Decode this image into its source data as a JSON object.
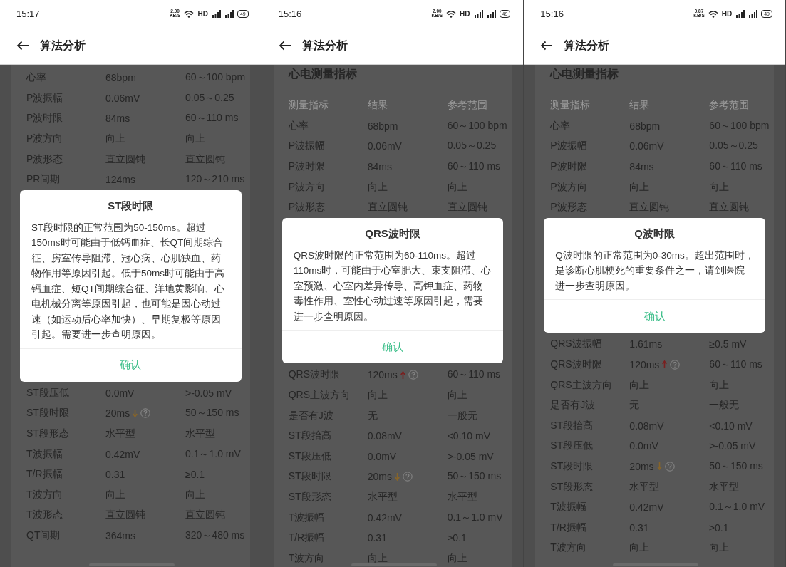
{
  "screens": [
    {
      "status_bar": {
        "time": "15:17",
        "net_speed": "2.00",
        "net_unit": "KB/S",
        "hd": "HD",
        "battery": "49"
      },
      "app_bar": {
        "title": "算法分析"
      },
      "rows": [
        {
          "name": "心率",
          "result": "68bpm",
          "reference": "60～100 bpm",
          "kind": "normal"
        },
        {
          "name": "P波振幅",
          "result": "0.06mV",
          "reference": "0.05～0.25",
          "kind": "normal"
        },
        {
          "name": "P波时限",
          "result": "84ms",
          "reference": "60～110 ms",
          "kind": "normal"
        },
        {
          "name": "P波方向",
          "result": "向上",
          "reference": "向上",
          "kind": "normal"
        },
        {
          "name": "P波形态",
          "result": "直立圆钝",
          "reference": "直立圆钝",
          "kind": "normal"
        },
        {
          "name": "PR间期",
          "result": "124ms",
          "reference": "120～210 ms",
          "kind": "normal"
        }
      ],
      "dialog": {
        "title": "ST段时限",
        "message": "ST段时限的正常范围为50-150ms。超过150ms时可能由于低钙血症、长QT间期综合征、房室传导阻滞、冠心病、心肌缺血、药物作用等原因引起。低于50ms时可能由于高钙血症、短QT间期综合征、洋地黄影响、心电机械分离等原因引起，也可能是因心动过速（如运动后心率加快）、早期复极等原因引起。需要进一步查明原因。",
        "button": "确认"
      },
      "rows_below": [
        {
          "name": "ST段压低",
          "result": "0.0mV",
          "reference": ">-0.05 mV",
          "kind": "normal"
        },
        {
          "name": "ST段时限",
          "result": "20ms",
          "reference": "50～150 ms",
          "kind": "low"
        },
        {
          "name": "ST段形态",
          "result": "水平型",
          "reference": "水平型",
          "kind": "normal"
        },
        {
          "name": "T波振幅",
          "result": "0.42mV",
          "reference": "0.1～1.0 mV",
          "kind": "normal"
        },
        {
          "name": "T/R振幅",
          "result": "0.31",
          "reference": "≥0.1",
          "kind": "normal"
        },
        {
          "name": "T波方向",
          "result": "向上",
          "reference": "向上",
          "kind": "normal"
        },
        {
          "name": "T波形态",
          "result": "直立圆钝",
          "reference": "直立圆钝",
          "kind": "normal"
        },
        {
          "name": "QT间期",
          "result": "364ms",
          "reference": "320～480 ms",
          "kind": "normal"
        }
      ]
    },
    {
      "status_bar": {
        "time": "15:16",
        "net_speed": "2.00",
        "net_unit": "KB/S",
        "hd": "HD",
        "battery": "49"
      },
      "app_bar": {
        "title": "算法分析"
      },
      "section_title": "心电测量指标",
      "columns": [
        "测量指标",
        "结果",
        "参考范围"
      ],
      "rows": [
        {
          "name": "心率",
          "result": "68bpm",
          "reference": "60～100 bpm",
          "kind": "normal"
        },
        {
          "name": "P波振幅",
          "result": "0.06mV",
          "reference": "0.05～0.25",
          "kind": "normal"
        },
        {
          "name": "P波时限",
          "result": "84ms",
          "reference": "60～110 ms",
          "kind": "normal"
        },
        {
          "name": "P波方向",
          "result": "向上",
          "reference": "向上",
          "kind": "normal"
        },
        {
          "name": "P波形态",
          "result": "直立圆钝",
          "reference": "直立圆钝",
          "kind": "normal"
        }
      ],
      "dialog": {
        "title": "QRS波时限",
        "message": "QRS波时限的正常范围为60-110ms。超过110ms时，可能由于心室肥大、束支阻滞、心室预激、心室内差异传导、高钾血症、药物毒性作用、室性心动过速等原因引起，需要进一步查明原因。",
        "button": "确认"
      },
      "rows_below": [
        {
          "name": "QRS波时限",
          "result": "120ms",
          "reference": "60～110 ms",
          "kind": "high"
        },
        {
          "name": "QRS主波方向",
          "result": "向上",
          "reference": "向上",
          "kind": "normal"
        },
        {
          "name": "是否有J波",
          "result": "无",
          "reference": "一般无",
          "kind": "normal"
        },
        {
          "name": "ST段抬高",
          "result": "0.08mV",
          "reference": "<0.10 mV",
          "kind": "normal"
        },
        {
          "name": "ST段压低",
          "result": "0.0mV",
          "reference": ">-0.05 mV",
          "kind": "normal"
        },
        {
          "name": "ST段时限",
          "result": "20ms",
          "reference": "50～150 ms",
          "kind": "low"
        },
        {
          "name": "ST段形态",
          "result": "水平型",
          "reference": "水平型",
          "kind": "normal"
        },
        {
          "name": "T波振幅",
          "result": "0.42mV",
          "reference": "0.1～1.0 mV",
          "kind": "normal"
        },
        {
          "name": "T/R振幅",
          "result": "0.31",
          "reference": "≥0.1",
          "kind": "normal"
        },
        {
          "name": "T波方向",
          "result": "向上",
          "reference": "向上",
          "kind": "normal"
        }
      ]
    },
    {
      "status_bar": {
        "time": "15:16",
        "net_speed": "0.87",
        "net_unit": "KB/S",
        "hd": "HD",
        "battery": "49"
      },
      "app_bar": {
        "title": "算法分析"
      },
      "section_title": "心电测量指标",
      "columns": [
        "测量指标",
        "结果",
        "参考范围"
      ],
      "rows": [
        {
          "name": "心率",
          "result": "68bpm",
          "reference": "60～100 bpm",
          "kind": "normal"
        },
        {
          "name": "P波振幅",
          "result": "0.06mV",
          "reference": "0.05～0.25",
          "kind": "normal"
        },
        {
          "name": "P波时限",
          "result": "84ms",
          "reference": "60～110 ms",
          "kind": "normal"
        },
        {
          "name": "P波方向",
          "result": "向上",
          "reference": "向上",
          "kind": "normal"
        },
        {
          "name": "P波形态",
          "result": "直立圆钝",
          "reference": "直立圆钝",
          "kind": "normal"
        }
      ],
      "dialog": {
        "title": "Q波时限",
        "message": "Q波时限的正常范围为0-30ms。超出范围时，是诊断心肌梗死的重要条件之一，请到医院进一步查明原因。",
        "button": "确认"
      },
      "rows_below": [
        {
          "name": "QRS波振幅",
          "result": "1.61ms",
          "reference": "≥0.5 mV",
          "kind": "normal"
        },
        {
          "name": "QRS波时限",
          "result": "120ms",
          "reference": "60～110 ms",
          "kind": "high"
        },
        {
          "name": "QRS主波方向",
          "result": "向上",
          "reference": "向上",
          "kind": "normal"
        },
        {
          "name": "是否有J波",
          "result": "无",
          "reference": "一般无",
          "kind": "normal"
        },
        {
          "name": "ST段抬高",
          "result": "0.08mV",
          "reference": "<0.10 mV",
          "kind": "normal"
        },
        {
          "name": "ST段压低",
          "result": "0.0mV",
          "reference": ">-0.05 mV",
          "kind": "normal"
        },
        {
          "name": "ST段时限",
          "result": "20ms",
          "reference": "50～150 ms",
          "kind": "low"
        },
        {
          "name": "ST段形态",
          "result": "水平型",
          "reference": "水平型",
          "kind": "normal"
        },
        {
          "name": "T波振幅",
          "result": "0.42mV",
          "reference": "0.1～1.0 mV",
          "kind": "normal"
        },
        {
          "name": "T/R振幅",
          "result": "0.31",
          "reference": "≥0.1",
          "kind": "normal"
        },
        {
          "name": "T波方向",
          "result": "向上",
          "reference": "向上",
          "kind": "normal"
        }
      ]
    }
  ]
}
